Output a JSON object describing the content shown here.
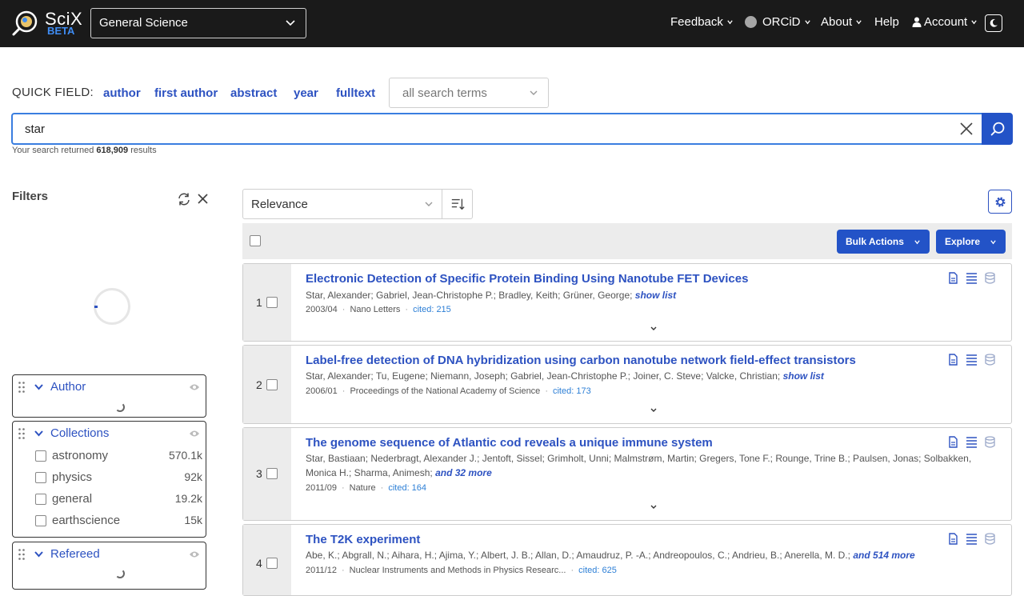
{
  "header": {
    "brand_name": "SciX",
    "brand_beta": "BETA",
    "discipline": "General Science",
    "nav": {
      "feedback": "Feedback",
      "orcid": "ORCiD",
      "about": "About",
      "help": "Help",
      "account": "Account"
    }
  },
  "quick_field": {
    "label": "QUICK FIELD:",
    "fields": [
      "author",
      "first author",
      "abstract",
      "year",
      "fulltext"
    ],
    "terms_select": "all search terms"
  },
  "search": {
    "value": "star",
    "results_prefix": "Your search returned",
    "results_count": "618,909",
    "results_suffix": "results"
  },
  "filters": {
    "title": "Filters",
    "author_facet": "Author",
    "collections_facet": "Collections",
    "collections": [
      {
        "label": "astronomy",
        "count": "570.1k"
      },
      {
        "label": "physics",
        "count": "92k"
      },
      {
        "label": "general",
        "count": "19.2k"
      },
      {
        "label": "earthscience",
        "count": "15k"
      }
    ],
    "refereed_facet": "Refereed"
  },
  "sort": {
    "value": "Relevance"
  },
  "toolbar": {
    "bulk_actions": "Bulk Actions",
    "explore": "Explore"
  },
  "results": [
    {
      "index": "1",
      "title": "Electronic Detection of Specific Protein Binding Using Nanotube FET Devices",
      "authors": "Star, Alexander; Gabriel, Jean-Christophe P.; Bradley, Keith; Grüner, George;",
      "more": "show list",
      "date": "2003/04",
      "journal": "Nano Letters",
      "cited": "cited: 215"
    },
    {
      "index": "2",
      "title": "Label-free detection of DNA hybridization using carbon nanotube network field-effect transistors",
      "authors": "Star, Alexander; Tu, Eugene; Niemann, Joseph; Gabriel, Jean-Christophe P.; Joiner, C. Steve; Valcke, Christian;",
      "more": "show list",
      "date": "2006/01",
      "journal": "Proceedings of the National Academy of Science",
      "cited": "cited: 173"
    },
    {
      "index": "3",
      "title": "The genome sequence of Atlantic cod reveals a unique immune system",
      "authors": "Star, Bastiaan; Nederbragt, Alexander J.; Jentoft, Sissel; Grimholt, Unni; Malmstrøm, Martin; Gregers, Tone F.; Rounge, Trine B.; Paulsen, Jonas; Solbakken, Monica H.; Sharma, Animesh;",
      "more": "and 32 more",
      "date": "2011/09",
      "journal": "Nature",
      "cited": "cited: 164"
    },
    {
      "index": "4",
      "title": "The T2K experiment",
      "authors": "Abe, K.; Abgrall, N.; Aihara, H.; Ajima, Y.; Albert, J. B.; Allan, D.; Amaudruz, P. -A.; Andreopoulos, C.; Andrieu, B.; Anerella, M. D.;",
      "more": "and 514 more",
      "date": "2011/12",
      "journal": "Nuclear Instruments and Methods in Physics Researc...",
      "cited": "cited: 625"
    }
  ]
}
